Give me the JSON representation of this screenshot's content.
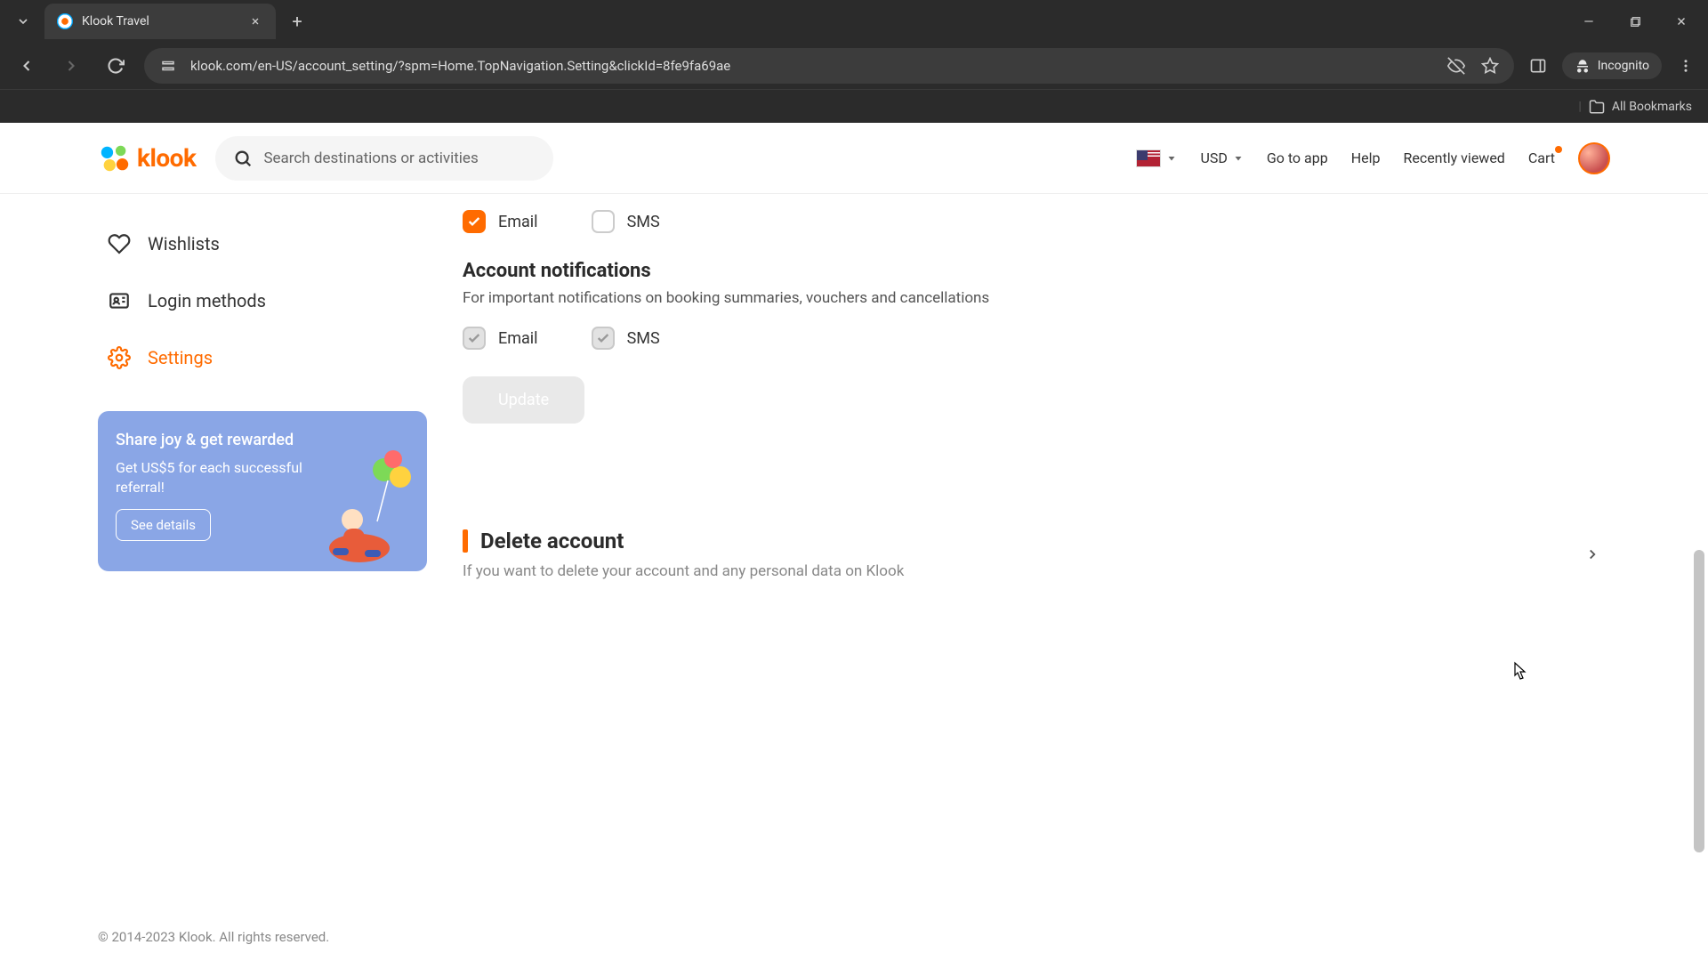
{
  "browser": {
    "tab_title": "Klook Travel",
    "url": "klook.com/en-US/account_setting/?spm=Home.TopNavigation.Setting&clickId=8fe9fa69ae",
    "incognito_label": "Incognito",
    "bookmarks_label": "All Bookmarks"
  },
  "header": {
    "logo_text": "klook",
    "search_placeholder": "Search destinations or activities",
    "currency": "USD",
    "nav": {
      "go_to_app": "Go to app",
      "help": "Help",
      "recently_viewed": "Recently viewed",
      "cart": "Cart"
    }
  },
  "sidebar": {
    "items": [
      {
        "label": "Wishlists"
      },
      {
        "label": "Login methods"
      },
      {
        "label": "Settings"
      }
    ],
    "promo": {
      "title": "Share joy & get rewarded",
      "subtitle": "Get US$5 for each successful referral!",
      "button": "See details"
    }
  },
  "settings": {
    "marketing": {
      "email_label": "Email",
      "sms_label": "SMS",
      "email_checked": true,
      "sms_checked": false
    },
    "account_notifications": {
      "title": "Account notifications",
      "subtitle": "For important notifications on booking summaries, vouchers and cancellations",
      "email_label": "Email",
      "sms_label": "SMS"
    },
    "update_label": "Update",
    "delete": {
      "title": "Delete account",
      "subtitle": "If you want to delete your account and any personal data on Klook"
    }
  },
  "footer": {
    "copyright": "© 2014-2023 Klook. All rights reserved."
  }
}
